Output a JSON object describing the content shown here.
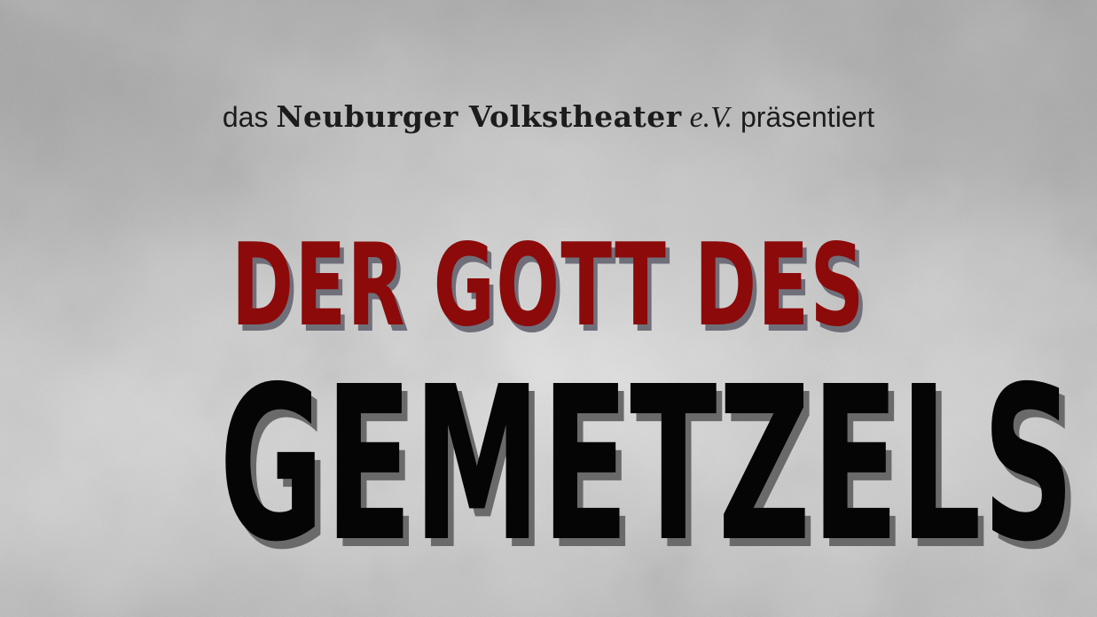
{
  "presenter": {
    "prefix": "das",
    "organization": "Neuburger Volkstheater",
    "org_suffix": "e.V.",
    "suffix": "präsentiert"
  },
  "title": {
    "line1": "DER GOTT DES",
    "line2": "GEMETZELS"
  },
  "colors": {
    "title_line1": "#8c0a0a",
    "title_line2": "#050505",
    "background": "#bdbdbd"
  }
}
